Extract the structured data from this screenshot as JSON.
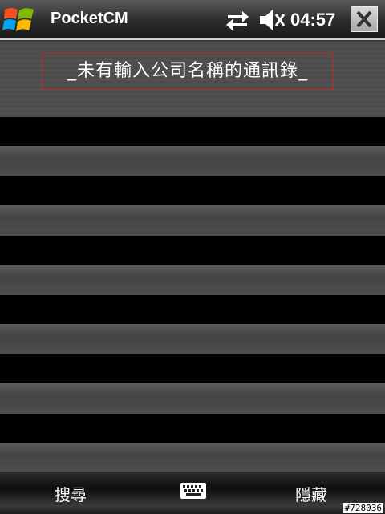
{
  "titlebar": {
    "app_title": "PocketCM",
    "time": "04:57",
    "icons": [
      "windows-start-icon",
      "connectivity-icon",
      "speaker-muted-icon",
      "close-icon"
    ]
  },
  "content": {
    "header_text": "_未有輸入公司名稱的通訊錄_",
    "rows": [
      {
        "text": ""
      },
      {
        "text": ""
      },
      {
        "text": ""
      },
      {
        "text": ""
      },
      {
        "text": ""
      },
      {
        "text": ""
      }
    ]
  },
  "bottombar": {
    "left_softkey": "搜尋",
    "right_softkey": "隱藏",
    "keyboard_icon": "keyboard-icon"
  },
  "watermark": "#728036",
  "colors": {
    "header_border": "#c0262a",
    "row_bar": "#000000"
  }
}
